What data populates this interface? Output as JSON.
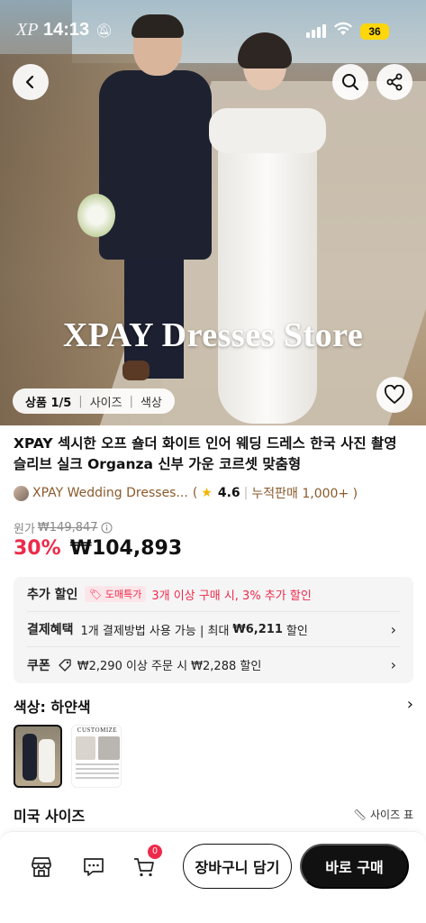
{
  "status_bar": {
    "brand": "XP",
    "time": "14:13",
    "battery": "36"
  },
  "hero": {
    "watermark": "XPAY Dresses Store",
    "pill": {
      "product": "상품 1/5",
      "size": "사이즈",
      "color": "색상"
    }
  },
  "product": {
    "title": "XPAY 섹시한 오프 숄더 화이트 인어 웨딩 드레스 한국 사진 촬영 슬리브 실크 Organza 신부 가운 코르셋 맞춤형",
    "store_name": "XPAY Wedding Dresses...",
    "rating": "4.6",
    "sales": "누적판매 1,000+ )",
    "open_paren": "(",
    "orig_label": "원가",
    "orig_price": "₩149,847",
    "discount": "30%",
    "price": "₩104,893"
  },
  "benefits": {
    "extra": {
      "label": "추가 할인",
      "tag": "도매특가",
      "text": "3개 이상 구매 시, 3% 추가 할인"
    },
    "payment": {
      "label": "결제혜택",
      "text_a": "1개 결제방법 사용 가능 | 최대",
      "amount": "₩6,211",
      "text_b": "할인"
    },
    "coupon": {
      "label": "쿠폰",
      "text": "₩2,290 이상 주문 시 ₩2,288 할인"
    }
  },
  "options": {
    "color_label": "색상: 하얀색",
    "customize_caption": "CUSTOMIZE",
    "size_label": "미국 사이즈",
    "size_guide": "사이즈 표"
  },
  "bottom_bar": {
    "cart_count": "0",
    "add_to_cart": "장바구니 담기",
    "buy_now": "바로 구매"
  },
  "colors": {
    "accent": "#ee2a4a",
    "star": "#f5b400",
    "store": "#8a5a2b"
  }
}
